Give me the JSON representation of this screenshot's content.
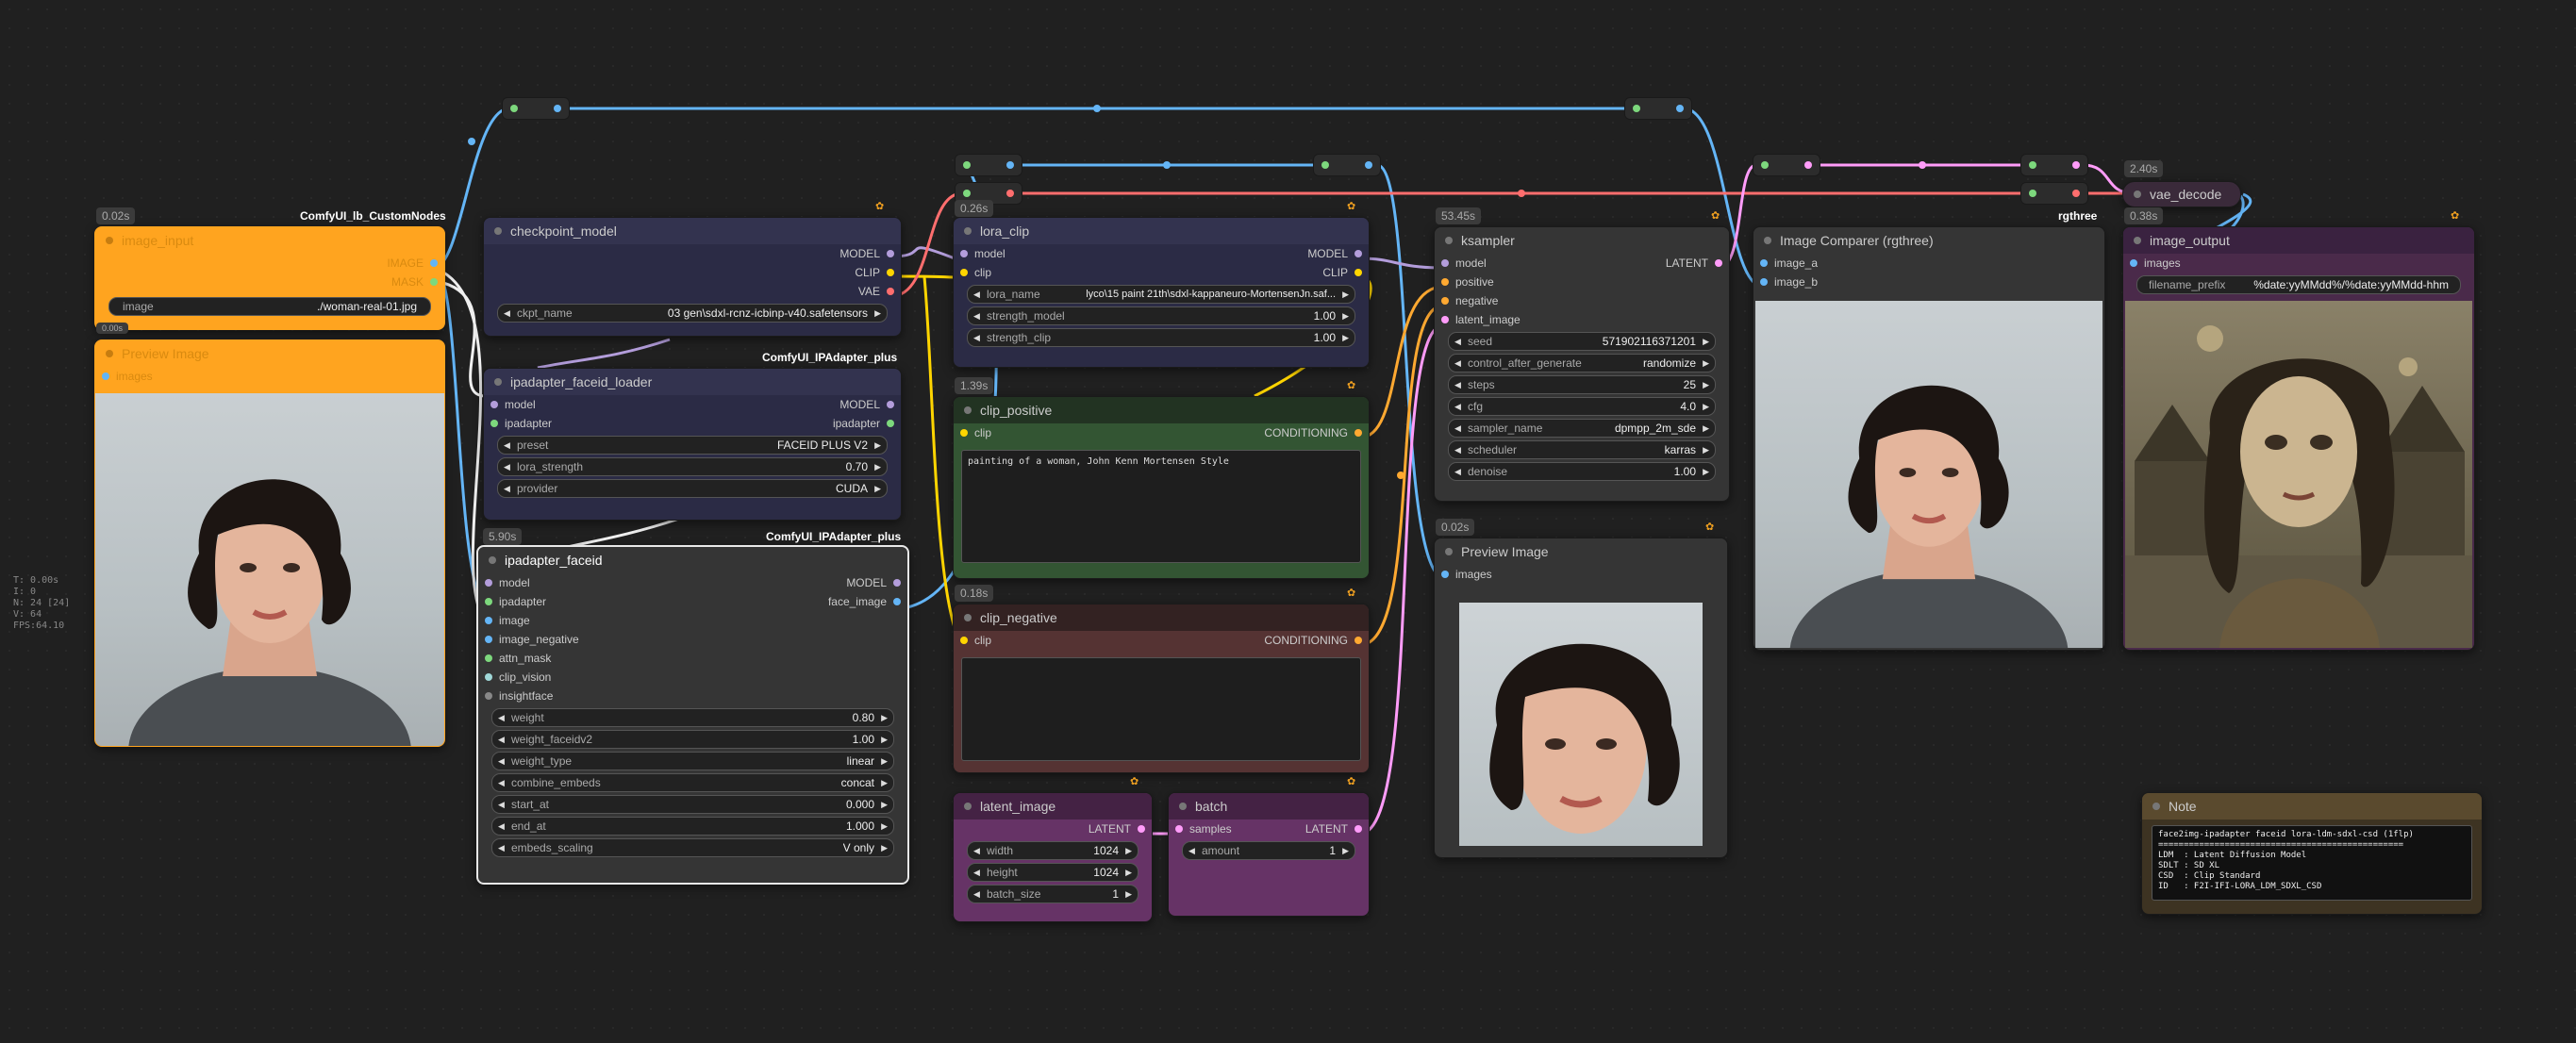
{
  "stats": [
    "T: 0.00s",
    "I: 0",
    "N: 24 [24]",
    "V: 64",
    "FPS:64.10"
  ],
  "colors": {
    "model": "#b39ddb",
    "clip": "#ffd500",
    "vae": "#ff6e6e",
    "conditioning": "#ffa931",
    "latent": "#ff9cf9",
    "image": "#64b5f6",
    "ipadapter": "#7dd87d",
    "misc": "#888888"
  },
  "image_input": {
    "time": "0.02s",
    "pack": "ComfyUI_lb_CustomNodes",
    "title": "image_input",
    "outputs": [
      "IMAGE",
      "MASK"
    ],
    "widget": {
      "label": "image",
      "value": "./woman-real-01.jpg"
    }
  },
  "preview_left": {
    "time": "0.00s",
    "title": "Preview Image",
    "input": "images"
  },
  "checkpoint_model": {
    "title": "checkpoint_model",
    "outputs": [
      "MODEL",
      "CLIP",
      "VAE"
    ],
    "widget": {
      "label": "ckpt_name",
      "value": "03 gen\\sdxl-rcnz-icbinp-v40.safetensors"
    }
  },
  "faceid_loader": {
    "pack": "ComfyUI_IPAdapter_plus",
    "title": "ipadapter_faceid_loader",
    "inputs": [
      "model",
      "ipadapter"
    ],
    "outputs": [
      "MODEL",
      "ipadapter"
    ],
    "widgets": [
      {
        "label": "preset",
        "value": "FACEID PLUS V2"
      },
      {
        "label": "lora_strength",
        "value": "0.70"
      },
      {
        "label": "provider",
        "value": "CUDA"
      }
    ]
  },
  "ipadapter_faceid": {
    "time": "5.90s",
    "pack": "ComfyUI_IPAdapter_plus",
    "title": "ipadapter_faceid",
    "inputs": [
      "model",
      "ipadapter",
      "image",
      "image_negative",
      "attn_mask",
      "clip_vision",
      "insightface"
    ],
    "outputs": [
      "MODEL",
      "face_image"
    ],
    "widgets": [
      {
        "label": "weight",
        "value": "0.80"
      },
      {
        "label": "weight_faceidv2",
        "value": "1.00"
      },
      {
        "label": "weight_type",
        "value": "linear"
      },
      {
        "label": "combine_embeds",
        "value": "concat"
      },
      {
        "label": "start_at",
        "value": "0.000"
      },
      {
        "label": "end_at",
        "value": "1.000"
      },
      {
        "label": "embeds_scaling",
        "value": "V only"
      }
    ]
  },
  "lora_clip": {
    "time": "0.26s",
    "title": "lora_clip",
    "inputs": [
      "model",
      "clip"
    ],
    "outputs": [
      "MODEL",
      "CLIP"
    ],
    "widgets": [
      {
        "label": "lora_name",
        "value": "lyco\\15 paint 21th\\sdxl-kappaneuro-MortensenJn.saf..."
      },
      {
        "label": "strength_model",
        "value": "1.00"
      },
      {
        "label": "strength_clip",
        "value": "1.00"
      }
    ]
  },
  "clip_positive": {
    "time": "1.39s",
    "title": "clip_positive",
    "input": "clip",
    "output": "CONDITIONING",
    "text": "painting of a woman, John Kenn Mortensen Style"
  },
  "clip_negative": {
    "time": "0.18s",
    "title": "clip_negative",
    "input": "clip",
    "output": "CONDITIONING",
    "text": ""
  },
  "latent_image": {
    "title": "latent_image",
    "output": "LATENT",
    "widgets": [
      {
        "label": "width",
        "value": "1024"
      },
      {
        "label": "height",
        "value": "1024"
      },
      {
        "label": "batch_size",
        "value": "1"
      }
    ]
  },
  "batch": {
    "title": "batch",
    "input": "samples",
    "output": "LATENT",
    "widget": {
      "label": "amount",
      "value": "1"
    }
  },
  "ksampler": {
    "time": "53.45s",
    "title": "ksampler",
    "inputs": [
      "model",
      "positive",
      "negative",
      "latent_image"
    ],
    "output": "LATENT",
    "widgets": [
      {
        "label": "seed",
        "value": "571902116371201"
      },
      {
        "label": "control_after_generate",
        "value": "randomize"
      },
      {
        "label": "steps",
        "value": "25"
      },
      {
        "label": "cfg",
        "value": "4.0"
      },
      {
        "label": "sampler_name",
        "value": "dpmpp_2m_sde"
      },
      {
        "label": "scheduler",
        "value": "karras"
      },
      {
        "label": "denoise",
        "value": "1.00"
      }
    ]
  },
  "preview_mid": {
    "time": "0.02s",
    "title": "Preview Image",
    "input": "images"
  },
  "comparer": {
    "title": "Image Comparer (rgthree)",
    "inputs": [
      "image_a",
      "image_b"
    ],
    "pack": "rgthree"
  },
  "vae_decode": {
    "time": "2.40s",
    "title": "vae_decode"
  },
  "image_output": {
    "time": "0.38s",
    "title": "image_output",
    "input": "images",
    "widget": {
      "label": "filename_prefix",
      "value": "%date:yyMMdd%/%date:yyMMdd-hhm"
    }
  },
  "note": {
    "title": "Note",
    "lines": [
      "face2img-ipadapter faceid lora-ldm-sdxl-csd (1flp)",
      "================================================",
      "LDM  : Latent Diffusion Model",
      "SDLT : SD XL",
      "CSD  : Clip Standard",
      "ID   : F2I-IFI-LORA_LDM_SDXL_CSD"
    ]
  }
}
